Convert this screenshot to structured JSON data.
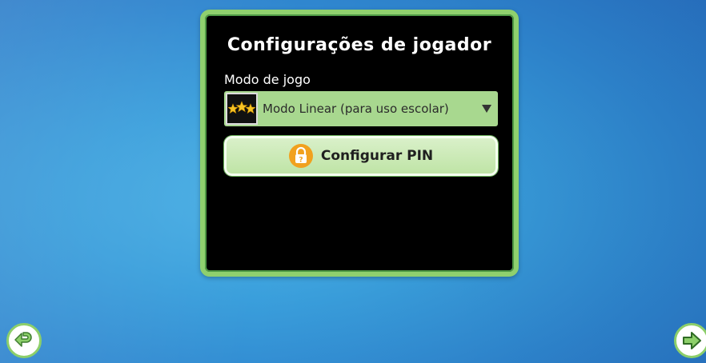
{
  "screen": {
    "title": "Configurações de jogador",
    "mode_label": "Modo de jogo"
  },
  "game_mode_select": {
    "selected": "Modo Linear (para uso escolar)",
    "icon": "three-stars-icon"
  },
  "pin_button": {
    "label": "Configurar PIN",
    "icon": "lock-icon"
  },
  "navigation": {
    "back_icon": "back-arrow-icon",
    "forward_icon": "forward-arrow-icon"
  },
  "colors": {
    "panel_border": "#8fd06e",
    "panel_background": "#000000",
    "button_fill": "#bfe4a6",
    "nav_accent": "#8dcf6a"
  }
}
